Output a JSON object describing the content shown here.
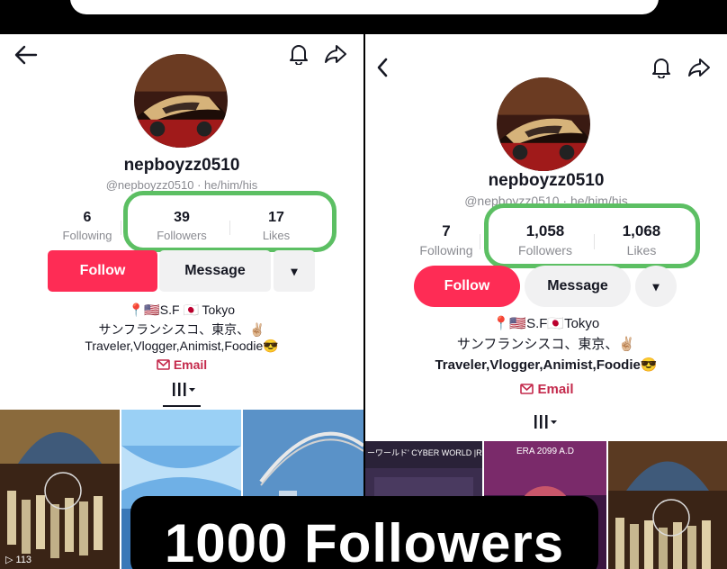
{
  "left": {
    "username": "nepboyzz0510",
    "handle": "@nepboyzz0510 · he/him/his",
    "stats": [
      {
        "num": "6",
        "label": "Following"
      },
      {
        "num": "39",
        "label": "Followers"
      },
      {
        "num": "17",
        "label": "Likes"
      }
    ],
    "buttons": {
      "follow": "Follow",
      "message": "Message",
      "more": "▾"
    },
    "bio": {
      "line1": "📍🇺🇸S.F 🇯🇵 Tokyo",
      "line2": "サンフランシスコ、東京、✌🏼",
      "line3": "Traveler,Vlogger,Animist,Foodie😎"
    },
    "email": "Email",
    "thumb_views": "113"
  },
  "right": {
    "username": "nepboyzz0510",
    "handle": "@nepboyzz0510 · he/him/his",
    "stats": [
      {
        "num": "7",
        "label": "Following"
      },
      {
        "num": "1,058",
        "label": "Followers"
      },
      {
        "num": "1,068",
        "label": "Likes"
      }
    ],
    "buttons": {
      "follow": "Follow",
      "message": "Message",
      "more": "▾"
    },
    "bio": {
      "line1": "📍🇺🇸S.F🇯🇵Tokyo",
      "line2": "サンフランシスコ、東京、✌🏼",
      "line3": "Traveler,Vlogger,Animist,Foodie😎"
    },
    "email": "Email",
    "thumbs": {
      "t1_title": "ーワールド' CYBER WORLD |Remas",
      "t2_title": "ERA 2099 A.D"
    }
  },
  "caption": "1000 Followers",
  "colors": {
    "accent": "#fe2c55",
    "highlight": "#5cbf63",
    "email": "#c42a4c"
  }
}
